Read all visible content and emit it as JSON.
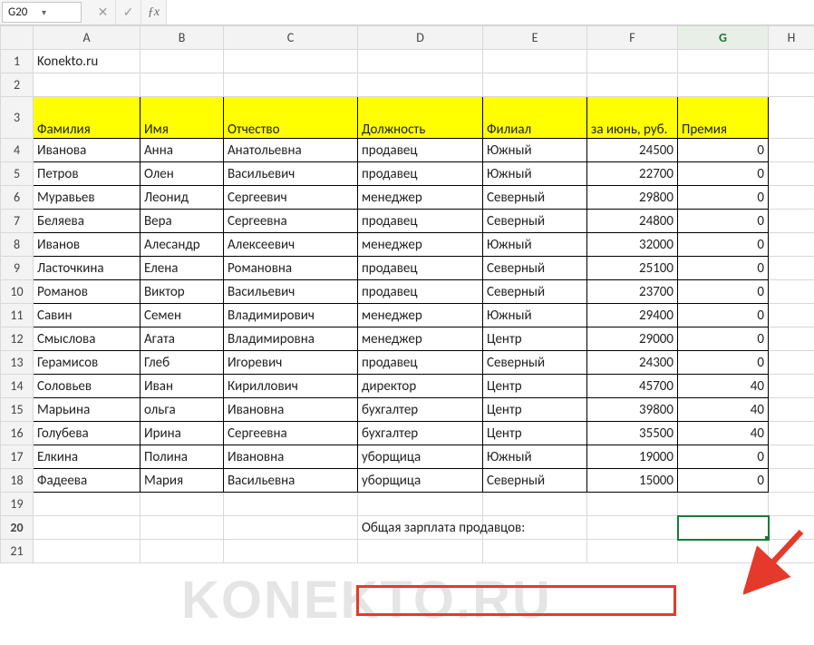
{
  "formula_bar": {
    "cell_ref": "G20",
    "formula": ""
  },
  "columns": [
    "A",
    "B",
    "C",
    "D",
    "E",
    "F",
    "G",
    "H"
  ],
  "title_cell": "Konekto.ru",
  "headers": {
    "A": "Фамилия",
    "B": "Имя",
    "C": "Отчество",
    "D": "Должность",
    "E": "Филиал",
    "F": "за июнь, руб.",
    "G": "Премия"
  },
  "rows": [
    {
      "A": "Иванова",
      "B": "Анна",
      "C": "Анатольевна",
      "D": "продавец",
      "E": "Южный",
      "F": 24500,
      "G": 0
    },
    {
      "A": "Петров",
      "B": "Олен",
      "C": "Васильевич",
      "D": "продавец",
      "E": "Южный",
      "F": 22700,
      "G": 0
    },
    {
      "A": "Муравьев",
      "B": "Леонид",
      "C": "Сергеевич",
      "D": "менеджер",
      "E": "Северный",
      "F": 29800,
      "G": 0
    },
    {
      "A": "Беляева",
      "B": "Вера",
      "C": "Сергеевна",
      "D": "продавец",
      "E": "Северный",
      "F": 24800,
      "G": 0
    },
    {
      "A": "Иванов",
      "B": "Алесандр",
      "C": "Алексеевич",
      "D": "менеджер",
      "E": "Южный",
      "F": 32000,
      "G": 0
    },
    {
      "A": "Ласточкина",
      "B": "Елена",
      "C": "Романовна",
      "D": "продавец",
      "E": "Северный",
      "F": 25100,
      "G": 0
    },
    {
      "A": "Романов",
      "B": "Виктор",
      "C": "Васильевич",
      "D": "продавец",
      "E": "Северный",
      "F": 23700,
      "G": 0
    },
    {
      "A": "Савин",
      "B": "Семен",
      "C": "Владимирович",
      "D": "менеджер",
      "E": "Южный",
      "F": 29400,
      "G": 0
    },
    {
      "A": "Смыслова",
      "B": "Агата",
      "C": "Владимировна",
      "D": "менеджер",
      "E": "Центр",
      "F": 29000,
      "G": 0
    },
    {
      "A": "Герамисов",
      "B": "Глеб",
      "C": "Игоревич",
      "D": "продавец",
      "E": "Северный",
      "F": 24300,
      "G": 0
    },
    {
      "A": "Соловьев",
      "B": "Иван",
      "C": "Кириллович",
      "D": "директор",
      "E": "Центр",
      "F": 45700,
      "G": 40
    },
    {
      "A": "Марьина",
      "B": "ольга",
      "C": "Ивановна",
      "D": "бухгалтер",
      "E": "Центр",
      "F": 39800,
      "G": 40
    },
    {
      "A": "Голубева",
      "B": "Ирина",
      "C": "Сергеевна",
      "D": "бухгалтер",
      "E": "Центр",
      "F": 35500,
      "G": 40
    },
    {
      "A": "Елкина",
      "B": "Полина",
      "C": "Ивановна",
      "D": "уборщица",
      "E": "Южный",
      "F": 19000,
      "G": 0
    },
    {
      "A": "Фадеева",
      "B": "Мария",
      "C": "Васильевна",
      "D": "уборщица",
      "E": "Северный",
      "F": 15000,
      "G": 0
    }
  ],
  "summary_label": "Общая зарплата продавцов:",
  "watermark": "KONEKTO.RU",
  "active_cell": "G20",
  "chart_data": {
    "type": "table",
    "title": "Konekto.ru",
    "columns": [
      "Фамилия",
      "Имя",
      "Отчество",
      "Должность",
      "Филиал",
      "за июнь, руб.",
      "Премия"
    ],
    "data": [
      [
        "Иванова",
        "Анна",
        "Анатольевна",
        "продавец",
        "Южный",
        24500,
        0
      ],
      [
        "Петров",
        "Олен",
        "Васильевич",
        "продавец",
        "Южный",
        22700,
        0
      ],
      [
        "Муравьев",
        "Леонид",
        "Сергеевич",
        "менеджер",
        "Северный",
        29800,
        0
      ],
      [
        "Беляева",
        "Вера",
        "Сергеевна",
        "продавец",
        "Северный",
        24800,
        0
      ],
      [
        "Иванов",
        "Алесандр",
        "Алексеевич",
        "менеджер",
        "Южный",
        32000,
        0
      ],
      [
        "Ласточкина",
        "Елена",
        "Романовна",
        "продавец",
        "Северный",
        25100,
        0
      ],
      [
        "Романов",
        "Виктор",
        "Васильевич",
        "продавец",
        "Северный",
        23700,
        0
      ],
      [
        "Савин",
        "Семен",
        "Владимирович",
        "менеджер",
        "Южный",
        29400,
        0
      ],
      [
        "Смыслова",
        "Агата",
        "Владимировна",
        "менеджер",
        "Центр",
        29000,
        0
      ],
      [
        "Герамисов",
        "Глеб",
        "Игоревич",
        "продавец",
        "Северный",
        24300,
        0
      ],
      [
        "Соловьев",
        "Иван",
        "Кириллович",
        "директор",
        "Центр",
        45700,
        40
      ],
      [
        "Марьина",
        "ольга",
        "Ивановна",
        "бухгалтер",
        "Центр",
        39800,
        40
      ],
      [
        "Голубева",
        "Ирина",
        "Сергеевна",
        "бухгалтер",
        "Центр",
        35500,
        40
      ],
      [
        "Елкина",
        "Полина",
        "Ивановна",
        "уборщица",
        "Южный",
        19000,
        0
      ],
      [
        "Фадеева",
        "Мария",
        "Васильевна",
        "уборщица",
        "Северный",
        15000,
        0
      ]
    ],
    "summary_row": {
      "label": "Общая зарплата продавцов:",
      "value": null
    }
  }
}
